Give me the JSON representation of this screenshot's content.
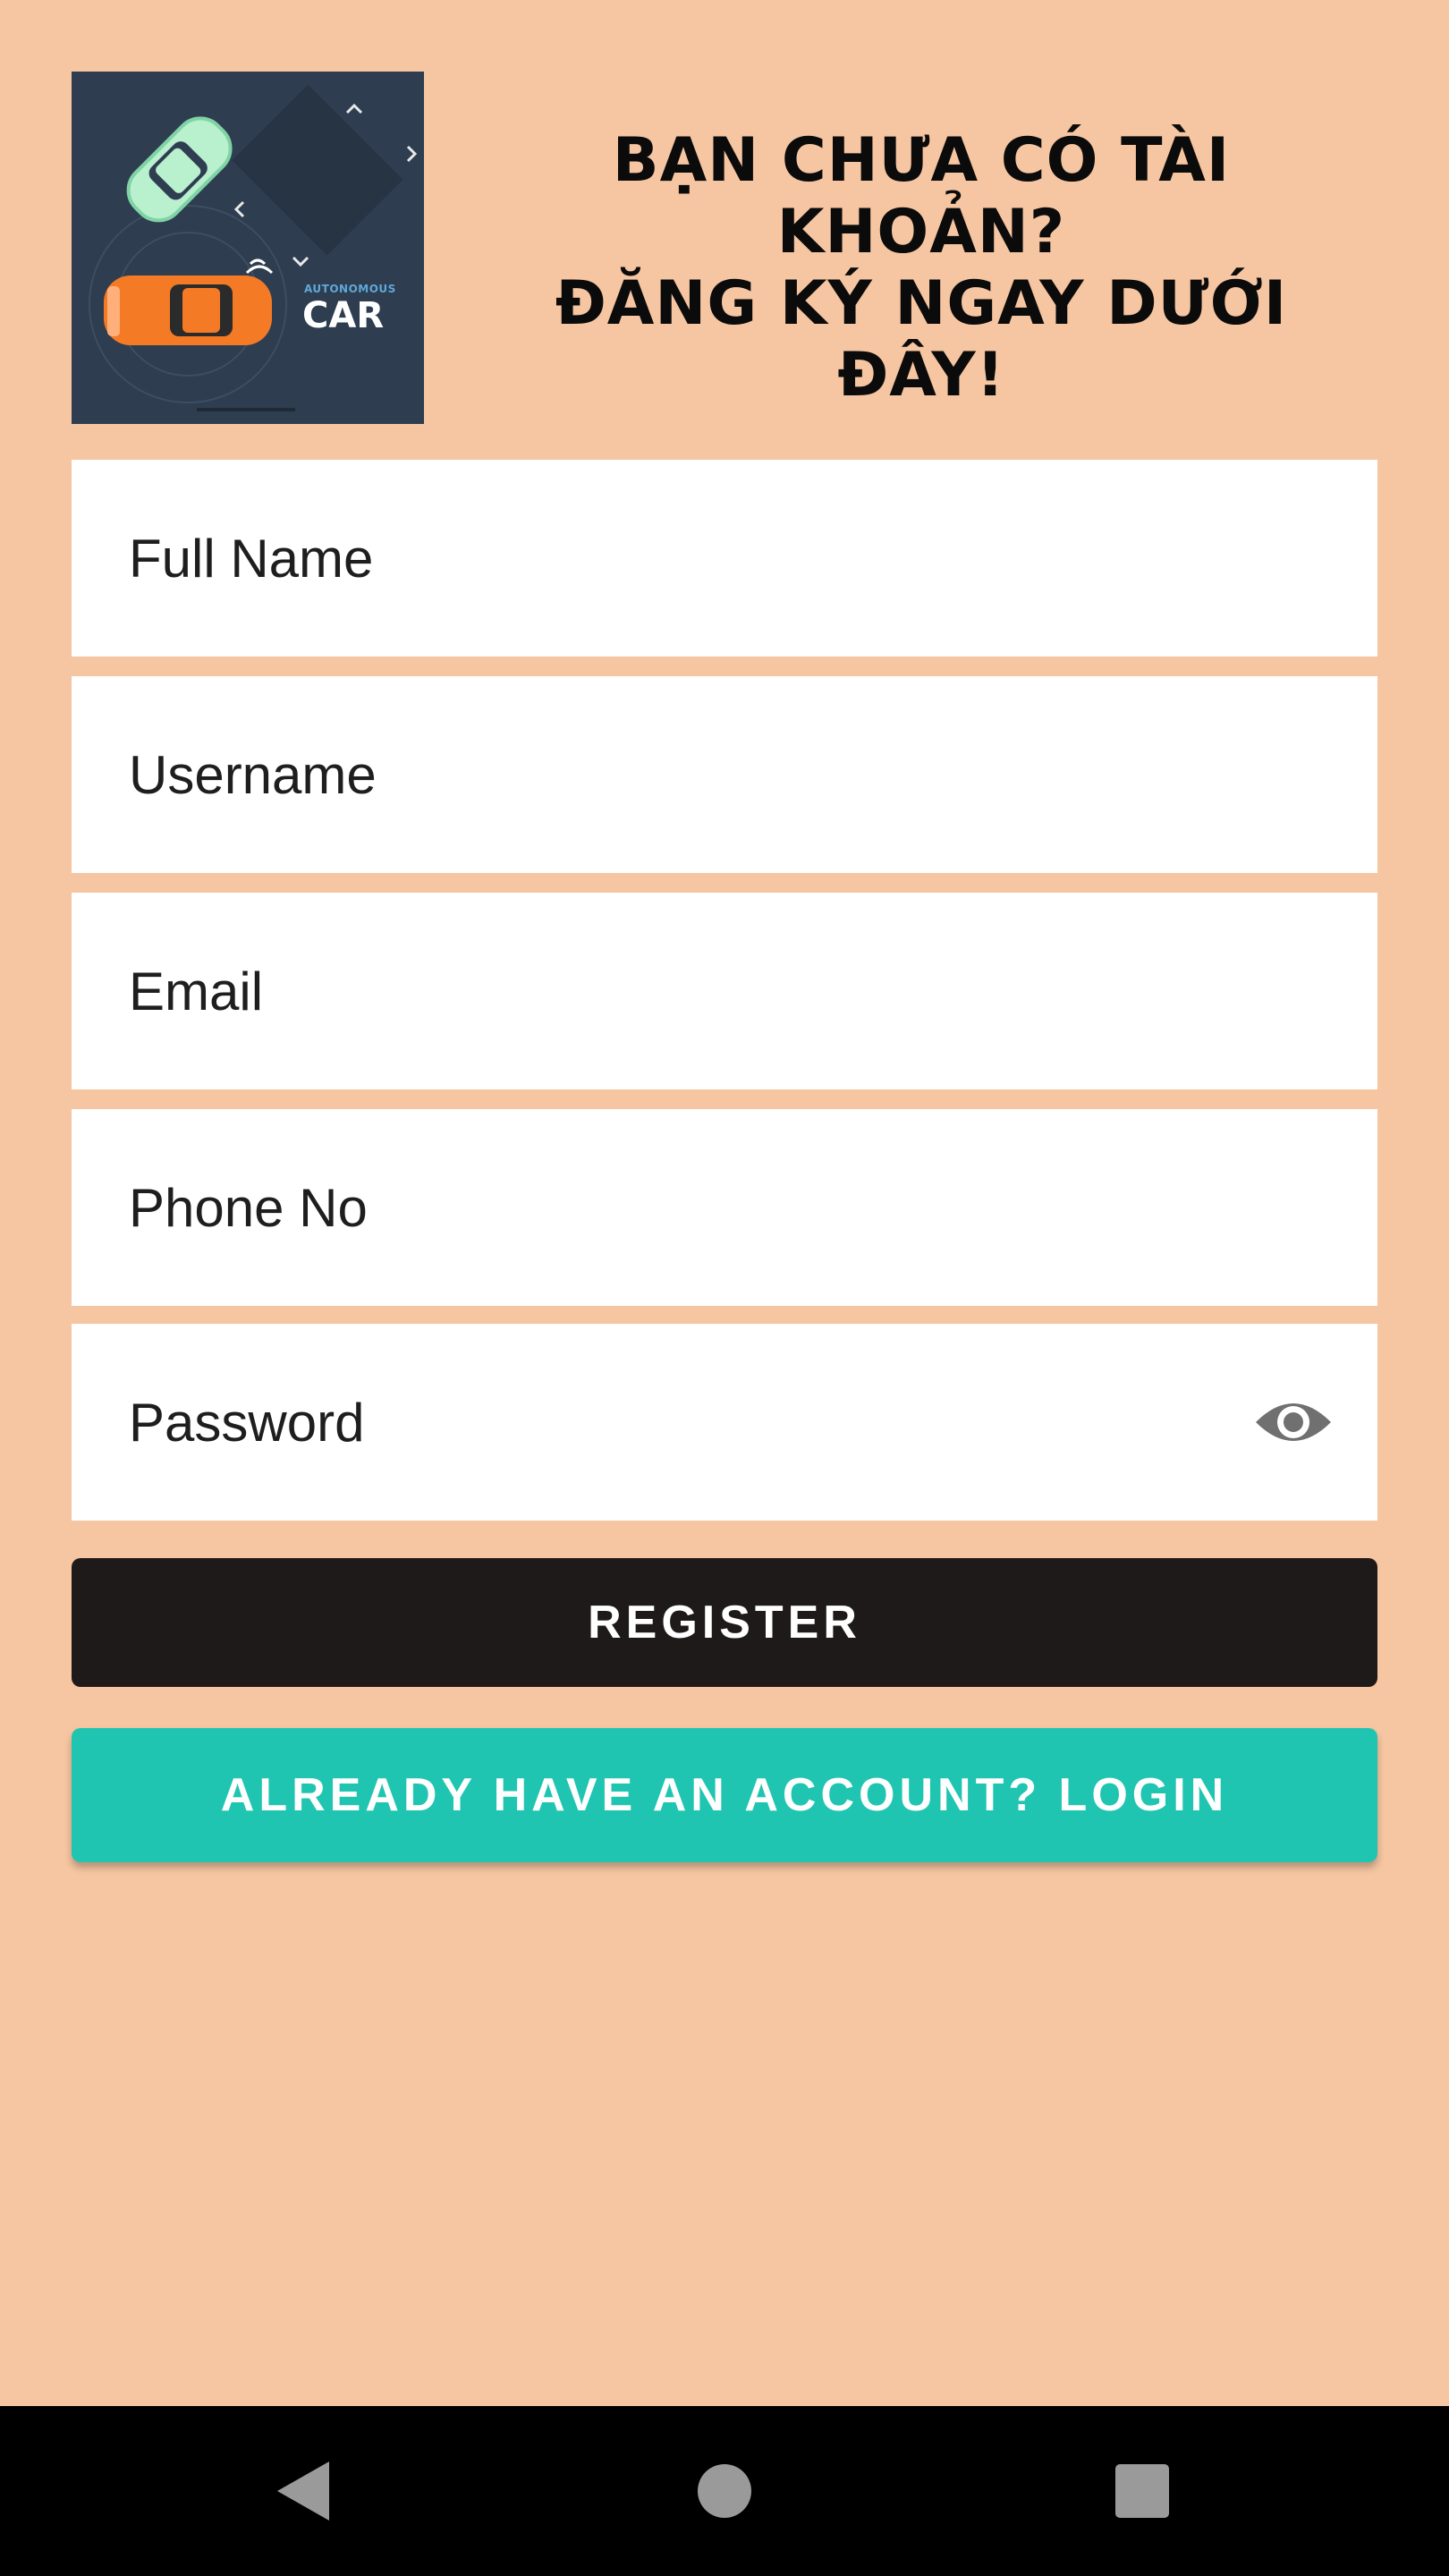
{
  "header": {
    "logo_small_text": "AUTONOMOUS",
    "logo_big_text": "CAR",
    "headline_lines": [
      "BẠN CHƯA CÓ TÀI",
      "KHOẢN?",
      "ĐĂNG KÝ NGAY DƯỚI",
      "ĐÂY!"
    ]
  },
  "form": {
    "full_name_placeholder": "Full Name",
    "username_placeholder": "Username",
    "email_placeholder": "Email",
    "phone_placeholder": "Phone No",
    "password_placeholder": "Password"
  },
  "buttons": {
    "register_label": "REGISTER",
    "login_label": "ALREADY HAVE AN ACCOUNT? LOGIN"
  },
  "icons": {
    "password_toggle": "eye-icon",
    "nav_back": "back-triangle-icon",
    "nav_home": "home-circle-icon",
    "nav_recents": "recents-square-icon"
  },
  "colors": {
    "background": "#f6c5a1",
    "register_button": "#1f1a1a",
    "login_button": "#20c5b2",
    "logo_background": "#2e3d50"
  }
}
